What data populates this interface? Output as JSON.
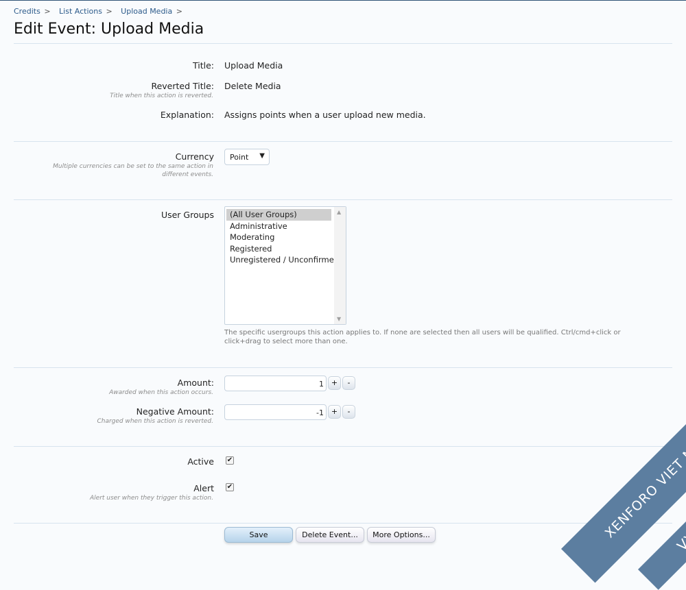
{
  "breadcrumb": [
    "Credits",
    "List Actions",
    "Upload Media"
  ],
  "breadcrumb_sep": ">",
  "page_title": "Edit Event: Upload Media",
  "fields": {
    "title": {
      "label": "Title:",
      "value": "Upload Media"
    },
    "reverted_title": {
      "label": "Reverted Title:",
      "hint": "Title when this action is reverted.",
      "value": "Delete Media"
    },
    "explanation": {
      "label": "Explanation:",
      "value": "Assigns points when a user upload new media."
    },
    "currency": {
      "label": "Currency",
      "hint": "Multiple currencies can be set to the same action in different events.",
      "selected": "Point",
      "arrow": "▼"
    },
    "user_groups": {
      "label": "User Groups",
      "options": [
        "(All User Groups)",
        "Administrative",
        "Moderating",
        "Registered",
        "Unregistered / Unconfirmed"
      ],
      "explain": "The specific usergroups this action applies to. If none are selected then all users will be qualified. Ctrl/cmd+click or click+drag to select more than one."
    },
    "amount": {
      "label": "Amount:",
      "hint": "Awarded when this action occurs.",
      "value": "1"
    },
    "negative_amount": {
      "label": "Negative Amount:",
      "hint": "Charged when this action is reverted.",
      "value": "-1"
    },
    "active": {
      "label": "Active",
      "checked": true
    },
    "alert": {
      "label": "Alert",
      "hint": "Alert user when they trigger this action.",
      "checked": true
    }
  },
  "spinner": {
    "plus": "+",
    "minus": "-"
  },
  "checkmark": "✔",
  "buttons": {
    "save": "Save",
    "delete": "Delete Event...",
    "more": "More Options..."
  },
  "watermark": {
    "line1": "XENFORO VIET NAM",
    "line2": "VXF.VN",
    "color": "#5c7ea0"
  },
  "colors": {
    "link": "#2b5a8a",
    "divider": "#d7e3ee",
    "background": "#f9fbfd"
  }
}
